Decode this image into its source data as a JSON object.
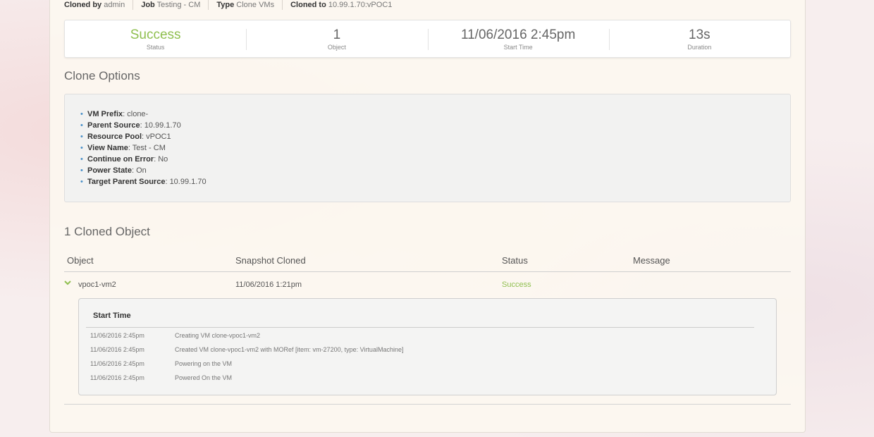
{
  "meta": {
    "cloned_by_label": "Cloned by",
    "cloned_by": "admin",
    "job_label": "Job",
    "job": "Testing - CM",
    "type_label": "Type",
    "type": "Clone VMs",
    "cloned_to_label": "Cloned to",
    "cloned_to": "10.99.1.70:vPOC1"
  },
  "stats": [
    {
      "value": "Success",
      "label": "Status"
    },
    {
      "value": "1",
      "label": "Object"
    },
    {
      "value": "11/06/2016 2:45pm",
      "label": "Start Time"
    },
    {
      "value": "13s",
      "label": "Duration"
    }
  ],
  "clone_options": {
    "title": "Clone Options",
    "items": [
      {
        "key": "VM Prefix",
        "value": ": clone-"
      },
      {
        "key": "Parent Source",
        "value": ": 10.99.1.70"
      },
      {
        "key": "Resource Pool",
        "value": ": vPOC1"
      },
      {
        "key": "View Name",
        "value": ": Test - CM"
      },
      {
        "key": "Continue on Error",
        "value": ": No"
      },
      {
        "key": "Power State",
        "value": ": On"
      },
      {
        "key": "Target Parent Source",
        "value": ": 10.99.1.70"
      }
    ]
  },
  "cloned_objects": {
    "title": "1 Cloned Object",
    "columns": [
      "Object",
      "Snapshot Cloned",
      "Status",
      "Message"
    ],
    "rows": [
      {
        "object": "vpoc1-vm2",
        "snapshot": "11/06/2016 1:21pm",
        "status": "Success",
        "message": ""
      }
    ]
  },
  "log": {
    "header": "Start Time",
    "entries": [
      {
        "time": "11/06/2016 2:45pm",
        "message": "Creating VM clone-vpoc1-vm2"
      },
      {
        "time": "11/06/2016 2:45pm",
        "message": "Created VM clone-vpoc1-vm2 with MORef [item: vm-27200, type: VirtualMachine]"
      },
      {
        "time": "11/06/2016 2:45pm",
        "message": "Powering on the VM"
      },
      {
        "time": "11/06/2016 2:45pm",
        "message": "Powered On the VM"
      }
    ]
  },
  "colors": {
    "success": "#8fbf4f",
    "bullet": "#4a90c8"
  },
  "icons": {
    "expand": "chevron-down-icon"
  }
}
